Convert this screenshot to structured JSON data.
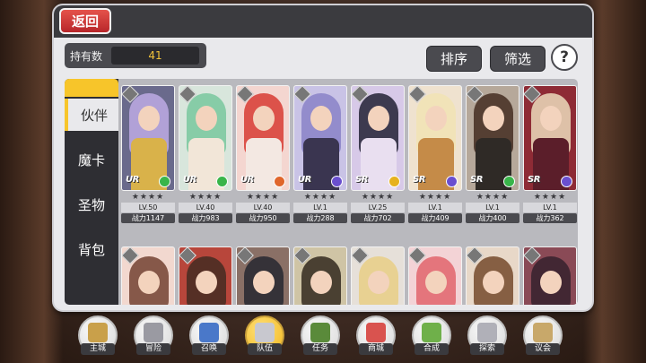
{
  "header": {
    "back_label": "返回"
  },
  "owned": {
    "label": "持有数",
    "value": "41"
  },
  "toolbar": {
    "sort_label": "排序",
    "filter_label": "筛选",
    "help_label": "?"
  },
  "side_tabs": [
    {
      "label": "伙伴",
      "active": true
    },
    {
      "label": "魔卡",
      "active": false
    },
    {
      "label": "圣物",
      "active": false
    },
    {
      "label": "背包",
      "active": false
    }
  ],
  "cards": [
    {
      "rarity": "UR",
      "stars": "★★★★",
      "lv": "LV.50",
      "power": "战力1147",
      "hair": "#b9a7df",
      "body": "#d9b24a",
      "bg": "#6a6a8c",
      "elem": "#39b54a"
    },
    {
      "rarity": "UR",
      "stars": "★★★★",
      "lv": "LV.40",
      "power": "战力983",
      "hair": "#7ec9a1",
      "body": "#f2e6d8",
      "bg": "#d8e6dc",
      "elem": "#39b54a"
    },
    {
      "rarity": "UR",
      "stars": "★★★★",
      "lv": "LV.40",
      "power": "战力950",
      "hair": "#d9443b",
      "body": "#f3e8e2",
      "bg": "#f4d6d0",
      "elem": "#e0662b"
    },
    {
      "rarity": "UR",
      "stars": "★★★★",
      "lv": "LV.1",
      "power": "战力288",
      "hair": "#8d86c9",
      "body": "#3a3550",
      "bg": "#c9c3e6",
      "elem": "#6a4fcf"
    },
    {
      "rarity": "SR",
      "stars": "★★★★",
      "lv": "LV.25",
      "power": "战力702",
      "hair": "#2c2a3e",
      "body": "#e9dff0",
      "bg": "#d7c9e8",
      "elem": "#e6b21f"
    },
    {
      "rarity": "SR",
      "stars": "★★★★",
      "lv": "LV.1",
      "power": "战力409",
      "hair": "#f1e3b5",
      "body": "#c58b48",
      "bg": "#efe2cf",
      "elem": "#6a4fcf"
    },
    {
      "rarity": "SR",
      "stars": "★★★★",
      "lv": "LV.1",
      "power": "战力400",
      "hair": "#4a3328",
      "body": "#2f2a26",
      "bg": "#b6a89a",
      "elem": "#39b54a"
    },
    {
      "rarity": "SR",
      "stars": "★★★★",
      "lv": "LV.1",
      "power": "战力362",
      "hair": "#e7d2b5",
      "body": "#5b1e2a",
      "bg": "#8e2b35",
      "elem": "#6a4fcf"
    }
  ],
  "cards_row2": [
    {
      "hair": "#7a4a3a",
      "bg": "#f2d8cf"
    },
    {
      "hair": "#4a2c24",
      "bg": "#b8463b"
    },
    {
      "hair": "#2b2b33",
      "bg": "#8a7066"
    },
    {
      "hair": "#3b3226",
      "bg": "#cfc4a5"
    },
    {
      "hair": "#e8cf8a",
      "bg": "#e6e0d9"
    },
    {
      "hair": "#e26a72",
      "bg": "#f3d3d6"
    },
    {
      "hair": "#7b5234",
      "bg": "#e8d8c8"
    },
    {
      "hair": "#3a2430",
      "bg": "#8a4a56"
    }
  ],
  "bottom_nav": [
    {
      "label": "主城",
      "icon": "castle-icon",
      "active": false,
      "color": "#c9a04a"
    },
    {
      "label": "冒险",
      "icon": "crossed-swords-icon",
      "active": false,
      "color": "#9a9aa2"
    },
    {
      "label": "召唤",
      "icon": "summon-cards-icon",
      "active": false,
      "color": "#4a78c9"
    },
    {
      "label": "队伍",
      "icon": "team-crest-icon",
      "active": true,
      "color": "#c8c8cf"
    },
    {
      "label": "任务",
      "icon": "quest-book-icon",
      "active": false,
      "color": "#5a8a3a"
    },
    {
      "label": "商城",
      "icon": "shop-icon",
      "active": false,
      "color": "#d9534f"
    },
    {
      "label": "合成",
      "icon": "craft-icon",
      "active": false,
      "color": "#6fb04a"
    },
    {
      "label": "探索",
      "icon": "explore-icon",
      "active": false,
      "color": "#b0b0b8"
    },
    {
      "label": "议会",
      "icon": "council-icon",
      "active": false,
      "color": "#c8a86a"
    }
  ]
}
